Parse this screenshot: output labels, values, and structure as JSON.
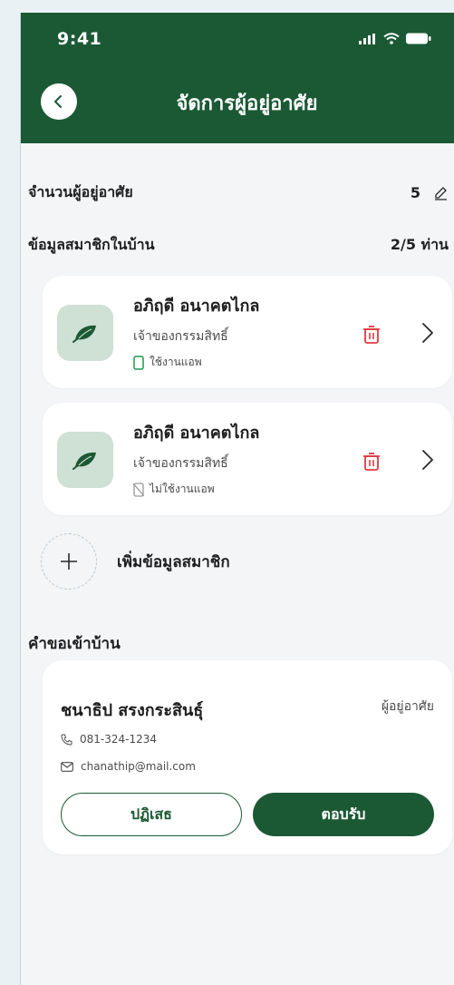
{
  "status_bar": {
    "time": "9:41"
  },
  "header": {
    "title": "จัดการผู้อยู่อาศัย"
  },
  "resident_count": {
    "label": "จำนวนผู้อยู่อาศัย",
    "value": "5"
  },
  "members_section": {
    "label": "ข้อมูลสมาชิกในบ้าน",
    "count": "2/5 ท่าน"
  },
  "members": [
    {
      "name": "อภิฤดี อนาคตไกล",
      "role": "เจ้าของกรรมสิทธิ์",
      "app_status": "ใช้งานแอพ",
      "app_active": true
    },
    {
      "name": "อภิฤดี อนาคตไกล",
      "role": "เจ้าของกรรมสิทธิ์",
      "app_status": "ไม่ใช้งานแอพ",
      "app_active": false
    }
  ],
  "add_member": {
    "label": "เพิ่มข้อมูลสมาชิก"
  },
  "requests_section": {
    "title": "คำขอเข้าบ้าน"
  },
  "request": {
    "name": "ชนาธิป สรงกระสินธุ์",
    "type": "ผู้อยู่อาศัย",
    "phone": "081-324-1234",
    "email": "chanathip@mail.com",
    "reject_label": "ปฏิเสธ",
    "accept_label": "ตอบรับ"
  },
  "colors": {
    "brand": "#1b5934",
    "delete": "#e0393e",
    "avatar_bg": "#cfe0d5"
  },
  "icons": [
    "back-arrow-icon",
    "signal-icon",
    "wifi-icon",
    "battery-icon",
    "edit-pencil-icon",
    "leaf-icon",
    "phone-device-icon",
    "phone-off-icon",
    "trash-icon",
    "chevron-right-icon",
    "plus-icon",
    "phone-icon",
    "mail-icon"
  ]
}
